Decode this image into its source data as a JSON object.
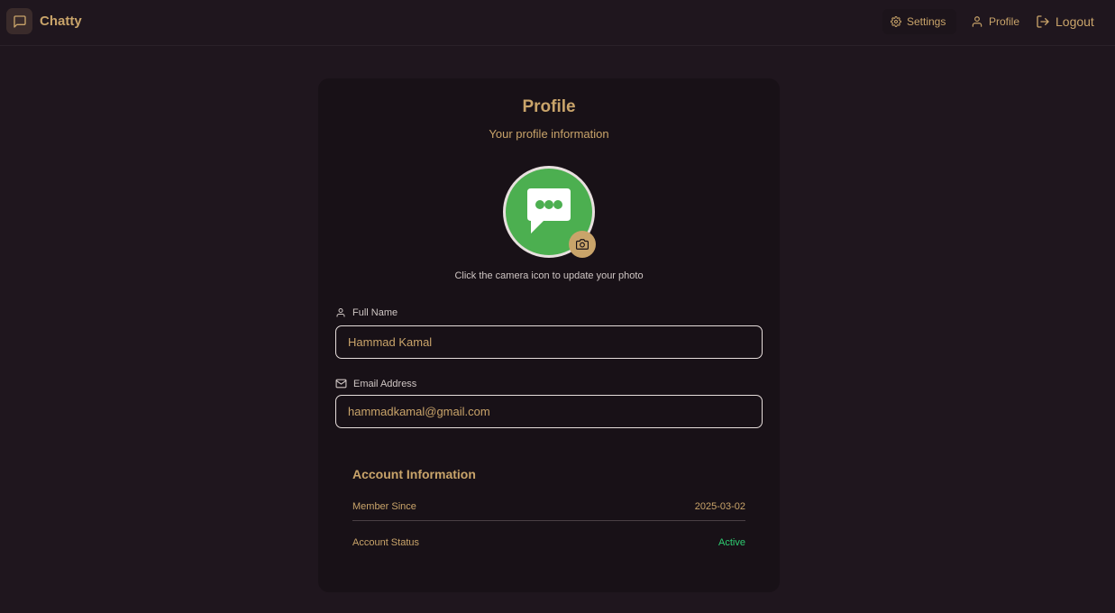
{
  "app": {
    "name": "Chatty"
  },
  "nav": {
    "settings": "Settings",
    "profile": "Profile",
    "logout": "Logout"
  },
  "profile_card": {
    "title": "Profile",
    "subtitle": "Your profile information",
    "photo_hint": "Click the camera icon to update your photo",
    "full_name_label": "Full Name",
    "full_name_value": "Hammad Kamal",
    "email_label": "Email Address",
    "email_value": "hammadkamal@gmail.com"
  },
  "account_info": {
    "title": "Account Information",
    "member_since_label": "Member Since",
    "member_since_value": "2025-03-02",
    "status_label": "Account Status",
    "status_value": "Active"
  },
  "colors": {
    "background": "#1f161e",
    "card": "#181117",
    "accent": "#c9a46a",
    "avatar_green": "#4caf50",
    "status_active": "#2ecc71"
  },
  "icons": {
    "brand": "message-square-icon",
    "settings": "gear-icon",
    "profile": "user-icon",
    "logout": "logout-icon",
    "camera": "camera-icon",
    "name_field": "user-icon",
    "email_field": "mail-icon"
  }
}
